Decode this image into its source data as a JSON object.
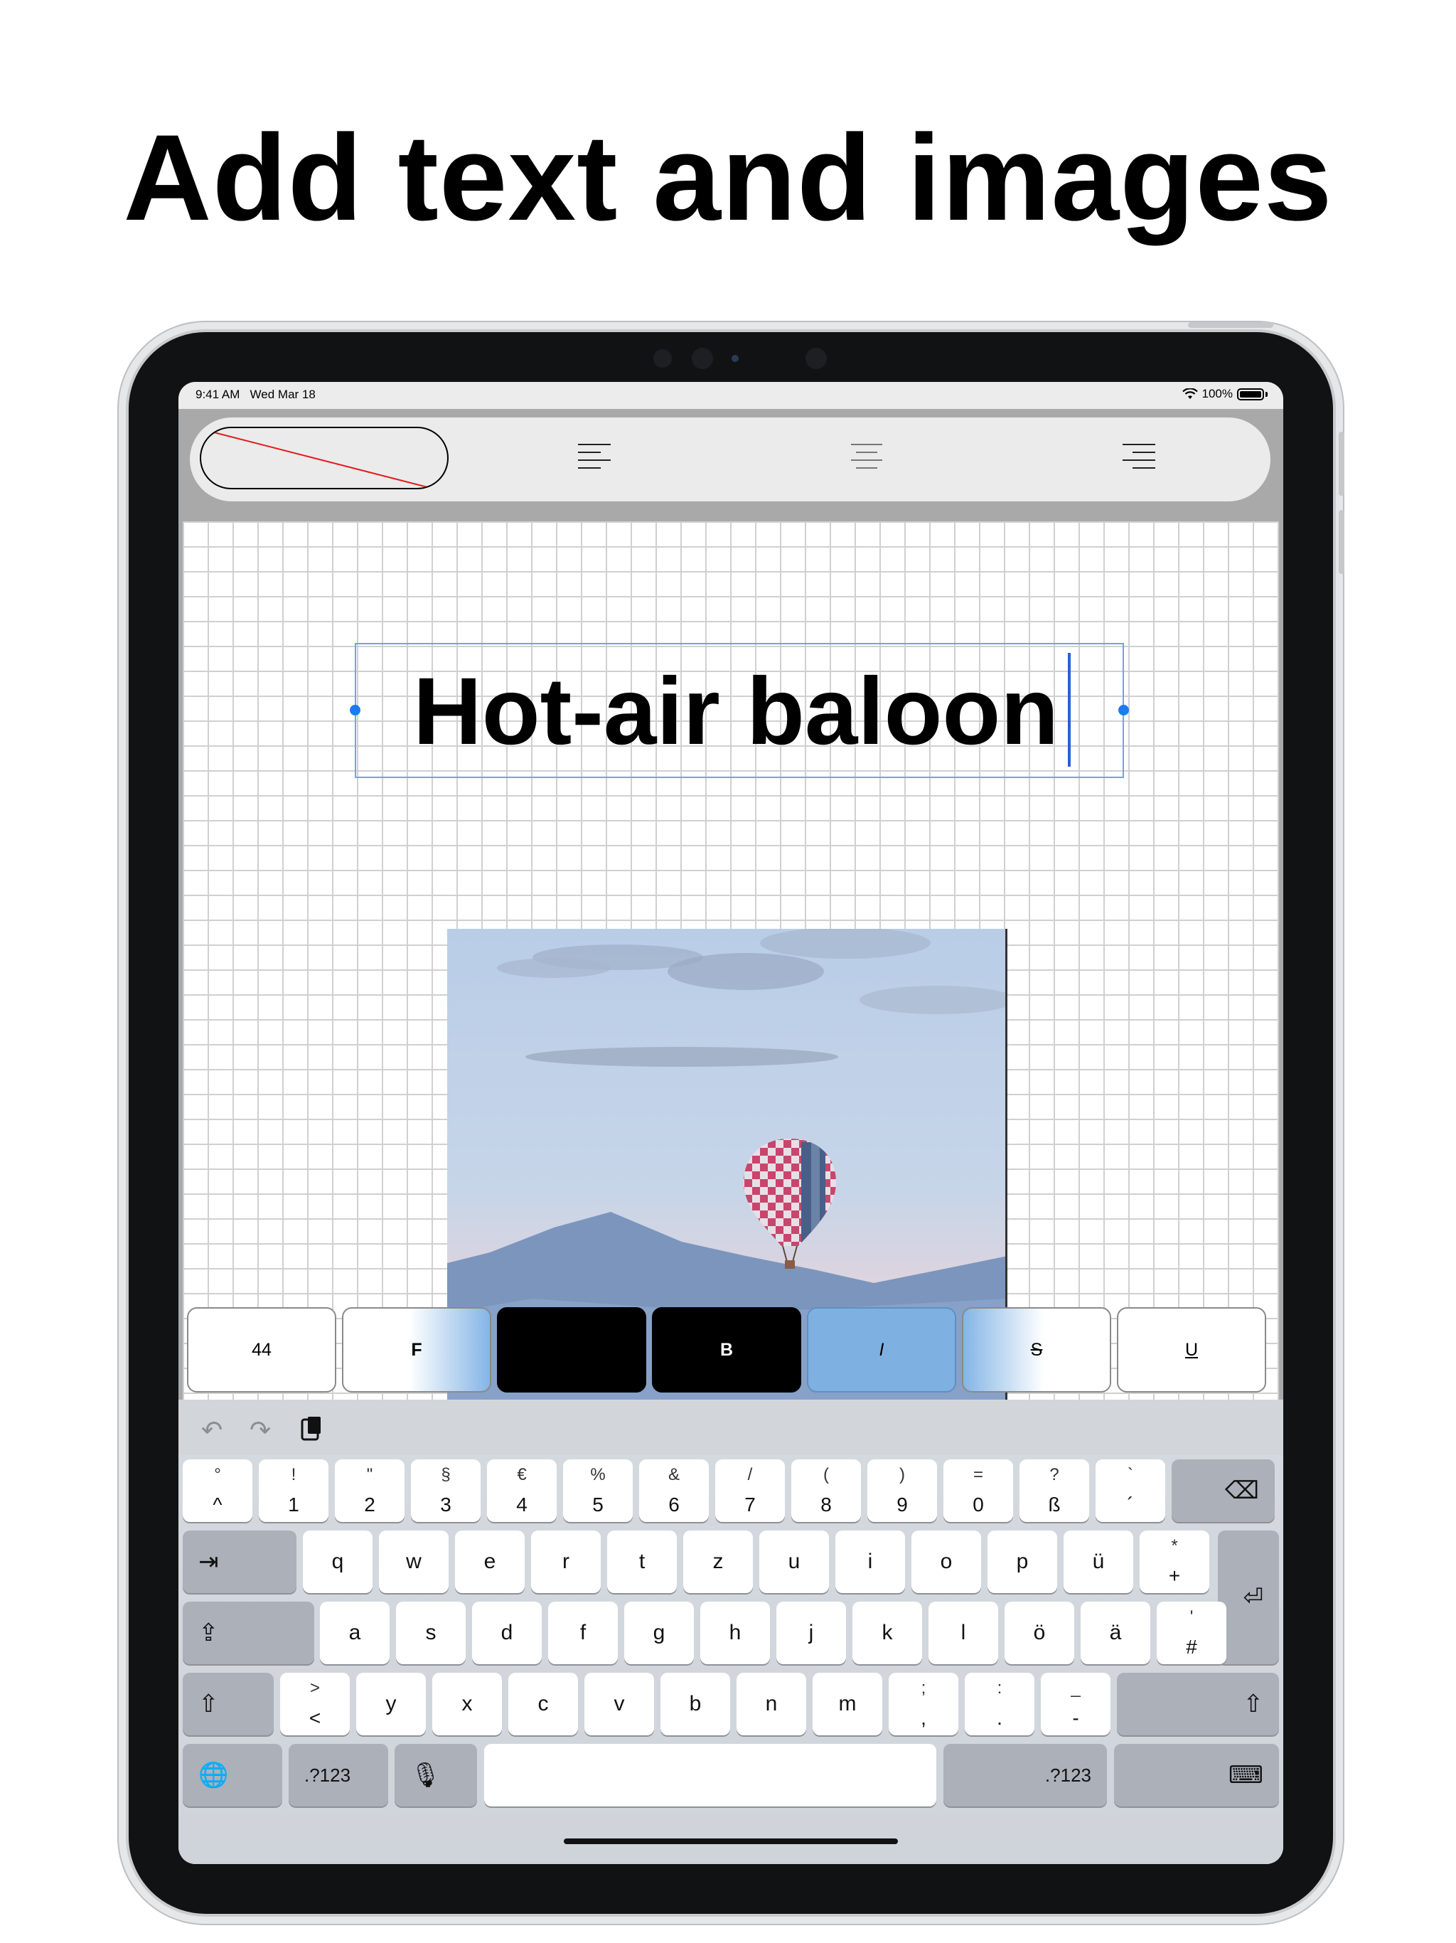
{
  "headline": "Add text and images",
  "status_bar": {
    "time": "9:41 AM",
    "date": "Wed Mar 18",
    "battery": "100%"
  },
  "toolbar": {
    "align_left": "align-left",
    "align_center": "align-center",
    "align_right": "align-right"
  },
  "canvas": {
    "text_box": {
      "text": "Hot-air baloon"
    }
  },
  "format_bar": {
    "size": "44",
    "font": "F",
    "color": "",
    "bold": "B",
    "italic": "I",
    "strike": "S",
    "underline": "U"
  },
  "keyboard": {
    "row1": [
      {
        "top": "°",
        "bottom": "^"
      },
      {
        "top": "!",
        "bottom": "1"
      },
      {
        "top": "\"",
        "bottom": "2"
      },
      {
        "top": "§",
        "bottom": "3"
      },
      {
        "top": "€",
        "bottom": "4"
      },
      {
        "top": "%",
        "bottom": "5"
      },
      {
        "top": "&",
        "bottom": "6"
      },
      {
        "top": "/",
        "bottom": "7"
      },
      {
        "top": "(",
        "bottom": "8"
      },
      {
        "top": ")",
        "bottom": "9"
      },
      {
        "top": "=",
        "bottom": "0"
      },
      {
        "top": "?",
        "bottom": "ß"
      },
      {
        "top": "`",
        "bottom": "´"
      }
    ],
    "row2": [
      "q",
      "w",
      "e",
      "r",
      "t",
      "z",
      "u",
      "i",
      "o",
      "p",
      "ü"
    ],
    "row2_extra": {
      "top": "*",
      "bottom": "+"
    },
    "row3": [
      "a",
      "s",
      "d",
      "f",
      "g",
      "h",
      "j",
      "k",
      "l",
      "ö",
      "ä"
    ],
    "row3_extra": {
      "top": "'",
      "bottom": "#"
    },
    "row4_first": {
      "top": ">",
      "bottom": "<"
    },
    "row4": [
      "y",
      "x",
      "c",
      "v",
      "b",
      "n",
      "m"
    ],
    "row4_punct": [
      {
        "top": ";",
        "bottom": ","
      },
      {
        "top": ":",
        "bottom": "."
      },
      {
        "top": "_",
        "bottom": "-"
      }
    ],
    "numbers_left": ".?123",
    "numbers_right": ".?123"
  },
  "icons": {
    "undo": "undo-icon",
    "redo": "redo-icon",
    "paste": "clipboard-icon",
    "delete": "delete-icon",
    "tab": "tab-icon",
    "caps": "caps-lock-icon",
    "return": "return-icon",
    "shift": "shift-icon",
    "globe": "globe-icon",
    "mic": "microphone-icon",
    "hide_keyboard": "hide-keyboard-icon"
  },
  "colors": {
    "selection": "#1a7bf2",
    "toolbar_bg": "#ebebeb",
    "canvas_grid": "#d0d0d0",
    "format_highlight": "#84b5e6"
  }
}
